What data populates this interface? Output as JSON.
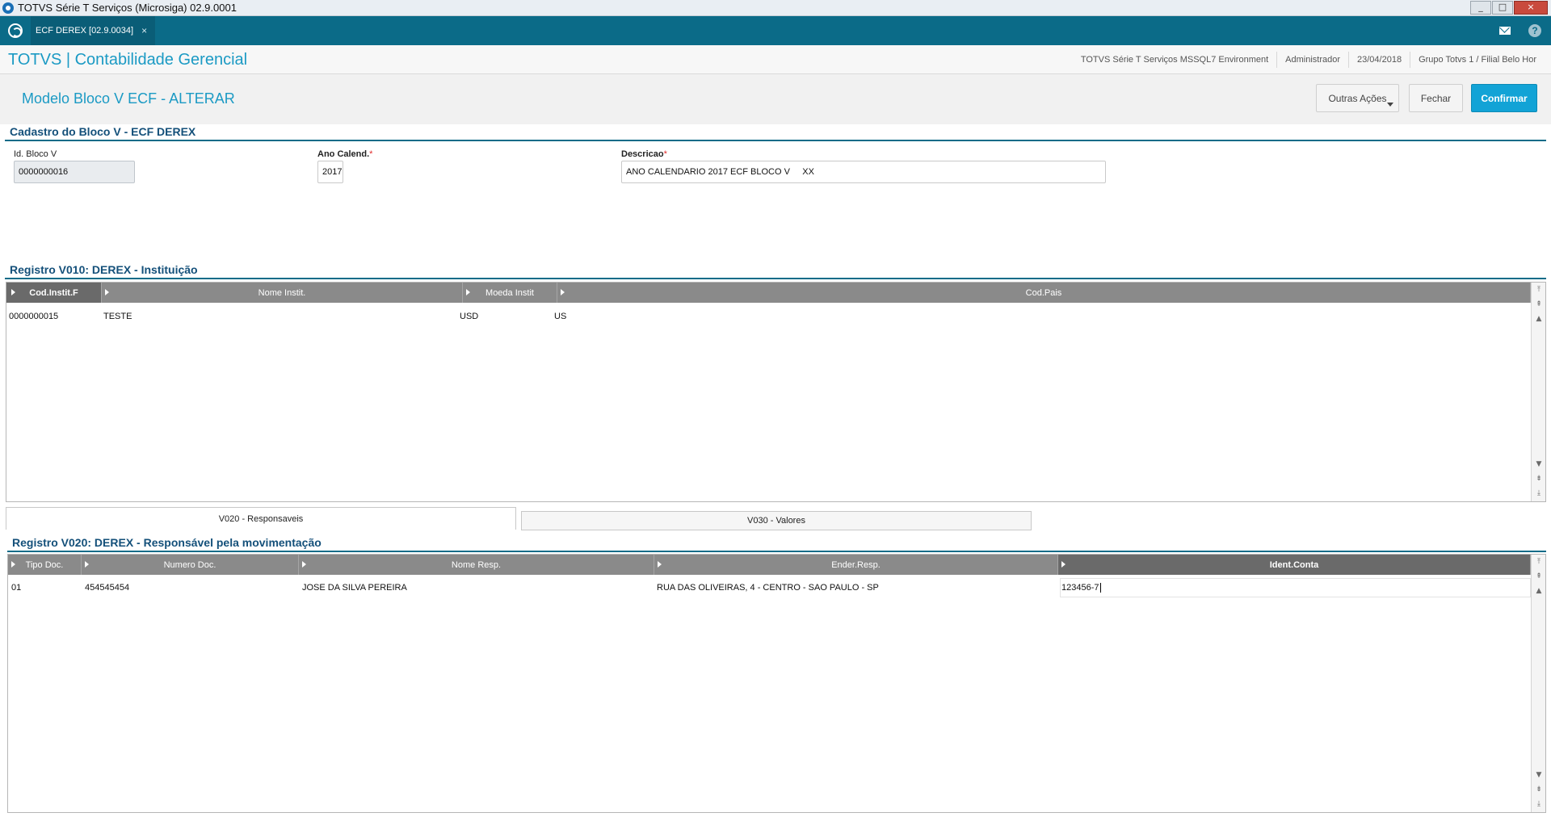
{
  "window": {
    "title": "TOTVS Série T Serviços (Microsiga) 02.9.0001",
    "min": "_",
    "max": "□",
    "close": "×"
  },
  "tabbar": {
    "tab_label": "ECF DEREX [02.9.0034]",
    "tab_close": "×",
    "help": "?"
  },
  "header": {
    "brand": "TOTVS | Contabilidade Gerencial",
    "environment": "TOTVS Série T Serviços MSSQL7 Environment",
    "user": "Administrador",
    "date": "23/04/2018",
    "branch": "Grupo Totvs 1 / Filial Belo Hor"
  },
  "page": {
    "title": "Modelo Bloco V ECF - ALTERAR",
    "buttons": {
      "outras": "Outras Ações",
      "fechar": "Fechar",
      "confirmar": "Confirmar"
    }
  },
  "cadastro": {
    "section_title": "Cadastro do Bloco V - ECF DEREX",
    "id_label": "Id. Bloco V",
    "id_value": "0000000016",
    "ano_label": "Ano Calend.",
    "ano_value": "2017",
    "desc_label": "Descricao",
    "desc_value": "ANO CALENDARIO 2017 ECF BLOCO V     XX",
    "required_mark": "*"
  },
  "v010": {
    "section_title": "Registro V010: DEREX - Instituição",
    "columns": [
      "Cod.Instit.F",
      "Nome Instit.",
      "Moeda Instit",
      "Cod.Pais"
    ],
    "rows": [
      [
        "0000000015",
        "TESTE",
        "USD",
        "US"
      ]
    ]
  },
  "folder_tabs": [
    "V020 - Responsaveis",
    "V030 - Valores"
  ],
  "v020": {
    "section_title": "Registro V020: DEREX - Responsável pela movimentação",
    "columns": [
      "Tipo Doc.",
      "Numero Doc.",
      "Nome Resp.",
      "Ender.Resp.",
      "Ident.Conta"
    ],
    "rows": [
      [
        "01",
        "454545454",
        "JOSE DA SILVA PEREIRA",
        "RUA DAS OLIVEIRAS, 4 - CENTRO - SAO PAULO - SP",
        "123456-7"
      ]
    ]
  },
  "colors": {
    "accent": "#1b9ac4",
    "tabbar": "#0b6b88",
    "confirm": "#12a3d6",
    "grid_header": "#8a8a8a"
  }
}
